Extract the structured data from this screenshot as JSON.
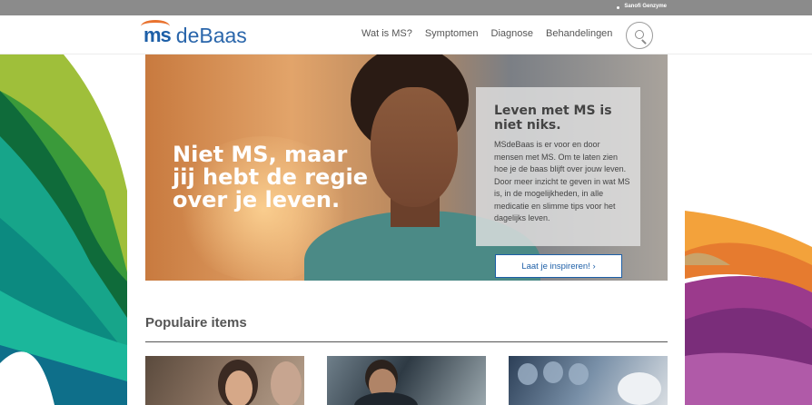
{
  "topbar": {
    "brand": "Sanofi Genzyme"
  },
  "header": {
    "logo_ms": "ms",
    "logo_name": "deBaas",
    "nav": [
      "Wat is MS?",
      "Symptomen",
      "Diagnose",
      "Behandelingen"
    ]
  },
  "hero": {
    "headline": "Niet MS, maar jij hebt de regie over je leven.",
    "card_title": "Leven met MS is niet niks.",
    "card_body": "MSdeBaas is er voor en door mensen met MS. Om te laten zien hoe je de baas blijft over jouw leven. Door meer inzicht te geven in wat MS is, in de mogelijkheden, in alle medicatie en slimme tips voor het dagelijks leven.",
    "cta": "Laat je inspireren! ›"
  },
  "popular": {
    "title": "Populaire items"
  },
  "colors": {
    "brand_blue": "#1d5fa7",
    "brand_orange": "#e9722e",
    "topbar_gray": "#8b8b8b"
  }
}
